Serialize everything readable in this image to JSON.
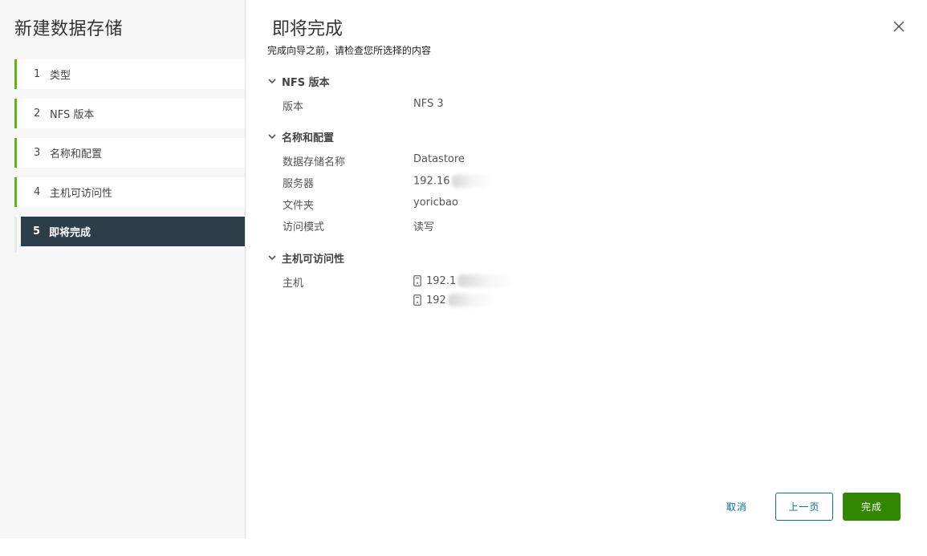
{
  "wizard": {
    "title": "新建数据存储",
    "steps": [
      {
        "num": "1",
        "label": "类型"
      },
      {
        "num": "2",
        "label": "NFS 版本"
      },
      {
        "num": "3",
        "label": "名称和配置"
      },
      {
        "num": "4",
        "label": "主机可访问性"
      },
      {
        "num": "5",
        "label": "即将完成"
      }
    ],
    "active_step": 5
  },
  "page": {
    "title": "即将完成",
    "subtitle": "完成向导之前，请检查您所选择的内容"
  },
  "sections": {
    "nfs": {
      "title": "NFS 版本",
      "rows": [
        {
          "key": "版本",
          "value": "NFS 3"
        }
      ]
    },
    "config": {
      "title": "名称和配置",
      "rows": [
        {
          "key": "数据存储名称",
          "value": "Datastore"
        },
        {
          "key": "服务器",
          "value": "192.16"
        },
        {
          "key": "文件夹",
          "value": "yoricbao"
        },
        {
          "key": "访问模式",
          "value": "读写"
        }
      ]
    },
    "hosts": {
      "title": "主机可访问性",
      "key": "主机",
      "items": [
        "192.1",
        "192"
      ]
    }
  },
  "footer": {
    "cancel_label": "取消",
    "prev_label": "上一页",
    "finish_label": "完成"
  },
  "colors": {
    "accent_green": "#60b515",
    "active_step_bg": "#2d3e4b",
    "finish_bg": "#318700",
    "link_blue": "#0072a3"
  },
  "icons": {
    "close": "close-icon",
    "chevron": "chevron-down-icon",
    "host": "server-icon"
  }
}
